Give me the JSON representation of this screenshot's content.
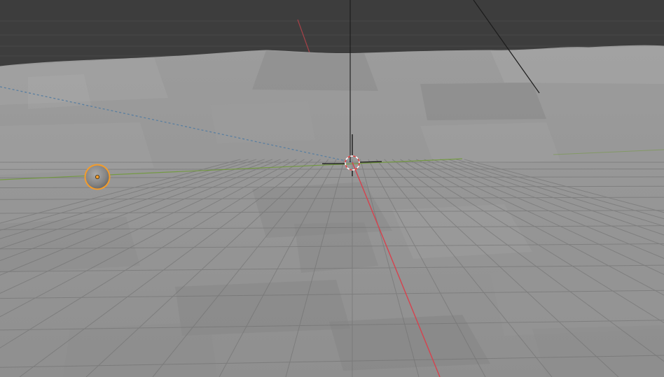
{
  "viewport": {
    "kind": "3d-viewport",
    "colors": {
      "background": "#3d3d3d",
      "terrain_base": "#8e8e8e",
      "terrain_light": "#a3a3a3",
      "terrain_dark": "#7a7a7a",
      "grid_line": "#707070",
      "x_axis": "#d6424e",
      "y_axis": "#6f9a36",
      "cursor_ring_red": "#e04040",
      "cursor_ring_white": "#ffffff",
      "selection_outline": "#f39c2b",
      "object_body": "#8a8a8a",
      "relationship_line": "#5a7fa0",
      "wire_line": "#1a1a1a"
    },
    "objects": [
      {
        "name": "sphere-object",
        "selected": true,
        "shape": "uv-sphere"
      },
      {
        "name": "terrain-mesh",
        "selected": false,
        "shape": "displaced-plane"
      }
    ],
    "cursor": {
      "name": "3d-cursor"
    },
    "grid": {
      "visible": true
    },
    "axes": {
      "x_visible": true,
      "y_visible": true
    }
  }
}
